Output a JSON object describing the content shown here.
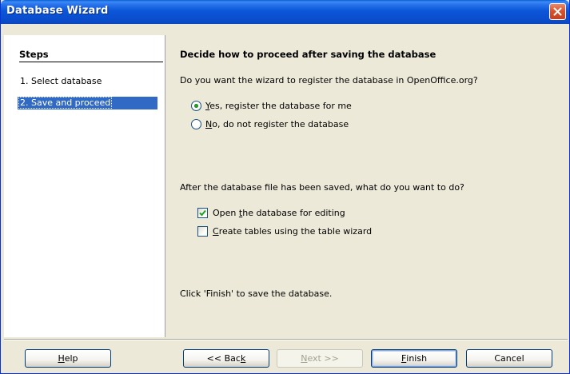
{
  "window": {
    "title": "Database Wizard"
  },
  "steps": {
    "heading": "Steps",
    "items": [
      {
        "label": "1. Select database",
        "active": false
      },
      {
        "label": "2. Save and proceed",
        "active": true
      }
    ]
  },
  "content": {
    "title": "Decide how to proceed after saving the database",
    "register_question": "Do you want the wizard to register the database in OpenOffice.org?",
    "register_options": [
      {
        "mnemonic": "Y",
        "rest": "es, register the database for me",
        "selected": true
      },
      {
        "mnemonic": "N",
        "rest": "o, do not register the database",
        "selected": false
      }
    ],
    "after_question": "After the database file has been saved, what do you want to do?",
    "after_options": [
      {
        "before": "Open ",
        "mnemonic": "t",
        "after": "he database for editing",
        "checked": true
      },
      {
        "before": "",
        "mnemonic": "C",
        "after": "reate tables using the table wizard",
        "checked": false
      }
    ],
    "finish_hint": "Click 'Finish' to save the database."
  },
  "buttons": {
    "help": {
      "mnemonic": "H",
      "rest": "elp"
    },
    "back": {
      "before": "<< Bac",
      "mnemonic": "k",
      "after": ""
    },
    "next": {
      "mnemonic": "N",
      "rest": "ext >>"
    },
    "finish": {
      "mnemonic": "F",
      "rest": "inish"
    },
    "cancel": "Cancel"
  },
  "colors": {
    "selection": "#316ac5",
    "radio_dot": "#22a022",
    "check_mark": "#21a121"
  }
}
